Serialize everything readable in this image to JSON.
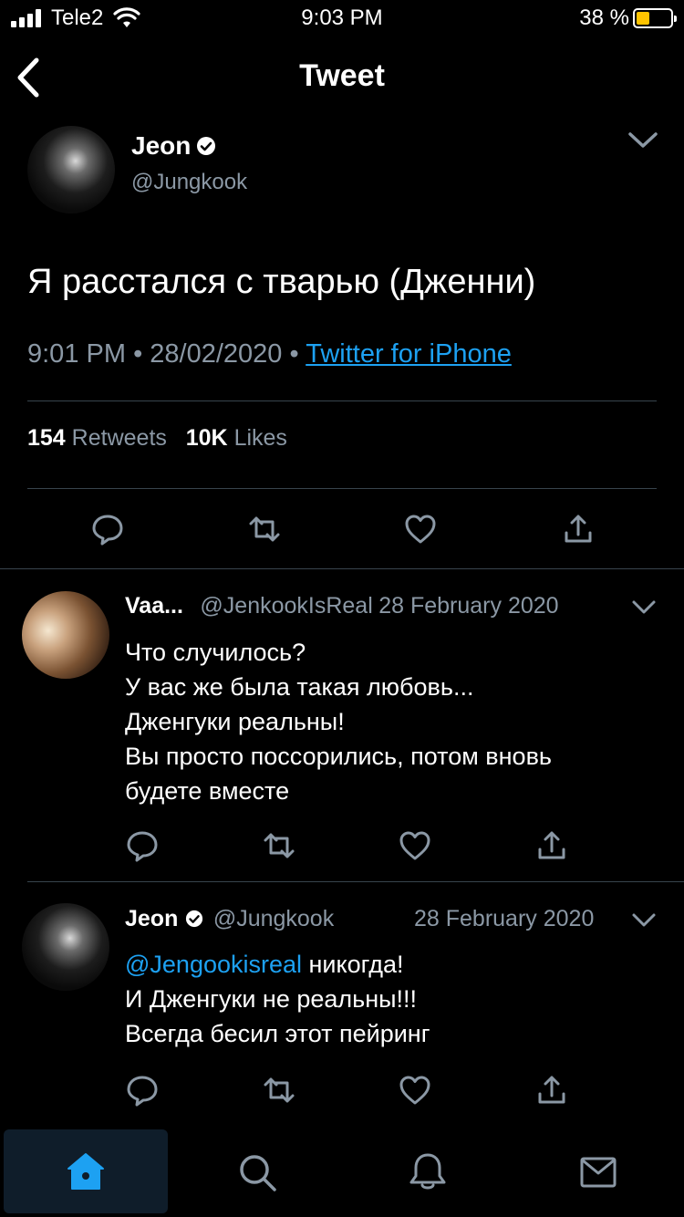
{
  "status_bar": {
    "carrier": "Tele2",
    "time": "9:03 PM",
    "battery_percent": "38 %",
    "icons": [
      "signal-icon",
      "wifi-icon",
      "battery-icon"
    ]
  },
  "header": {
    "title": "Tweet",
    "back_icon": "chevron-left-icon"
  },
  "tweet": {
    "author_name": "Jeon",
    "author_handle": "@Jungkook",
    "text": "Я расстался с тварью (Дженни)",
    "time": "9:01 PM",
    "separator1": "•",
    "date": "28/02/2020",
    "separator2": "•",
    "source": "Twitter for iPhone",
    "retweets_count": "154",
    "retweets_label": "Retweets",
    "likes_count": "10K",
    "likes_label": "Likes"
  },
  "replies": [
    {
      "name": "Vaa...",
      "handle": "@JenkookIsReal",
      "date": "28 February 2020",
      "lines": [
        "Что случилось?",
        "У вас же была такая любовь...",
        "Дженгуки реальны!",
        "Вы просто поссорились, потом вновь",
        "будете вместе"
      ]
    },
    {
      "name": "Jeon",
      "handle": "@Jungkook",
      "date": "28 February 2020",
      "mention": "@Jengookisreal",
      "line1_rest": " никогда!",
      "lines": [
        "И Дженгуки не реальны!!!",
        "Всегда бесил этот пейринг"
      ]
    }
  ],
  "colors": {
    "background": "#000000",
    "accent": "#1da1f2",
    "secondary_text": "#8b98a5",
    "divider": "#38444d",
    "battery_fill": "#ffc400"
  },
  "tab_bar": {
    "items": [
      "home-icon",
      "search-icon",
      "notifications-icon",
      "messages-icon"
    ],
    "active": "home-icon"
  }
}
